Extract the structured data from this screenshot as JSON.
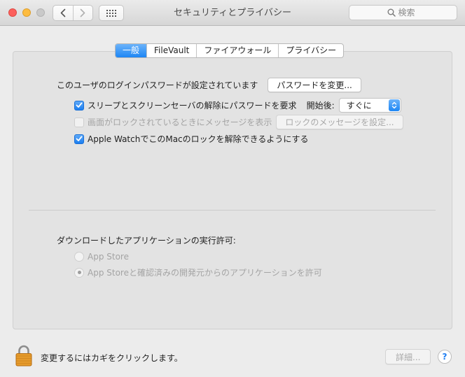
{
  "window": {
    "title": "セキュリティとプライバシー",
    "search_placeholder": "検索"
  },
  "tabs": [
    {
      "label": "一般",
      "active": true
    },
    {
      "label": "FileVault",
      "active": false
    },
    {
      "label": "ファイアウォール",
      "active": false
    },
    {
      "label": "プライバシー",
      "active": false
    }
  ],
  "general": {
    "password_label": "このユーザのログインパスワードが設定されています",
    "change_password_button": "パスワードを変更...",
    "require_password": {
      "label": "スリープとスクリーンセーバの解除にパスワードを要求",
      "checked": true,
      "after_label": "開始後:",
      "after_value": "すぐに"
    },
    "show_message": {
      "label": "画面がロックされているときにメッセージを表示",
      "checked": false,
      "enabled": false,
      "button": "ロックのメッセージを設定..."
    },
    "apple_watch": {
      "label": "Apple WatchでこのMacのロックを解除できるようにする",
      "checked": true
    }
  },
  "downloads": {
    "heading": "ダウンロードしたアプリケーションの実行許可:",
    "options": [
      {
        "label": "App Store",
        "selected": false
      },
      {
        "label": "App Storeと確認済みの開発元からのアプリケーションを許可",
        "selected": true
      }
    ]
  },
  "footer": {
    "lock_text": "変更するにはカギをクリックします。",
    "advanced_button": "詳細...",
    "help_label": "?"
  }
}
